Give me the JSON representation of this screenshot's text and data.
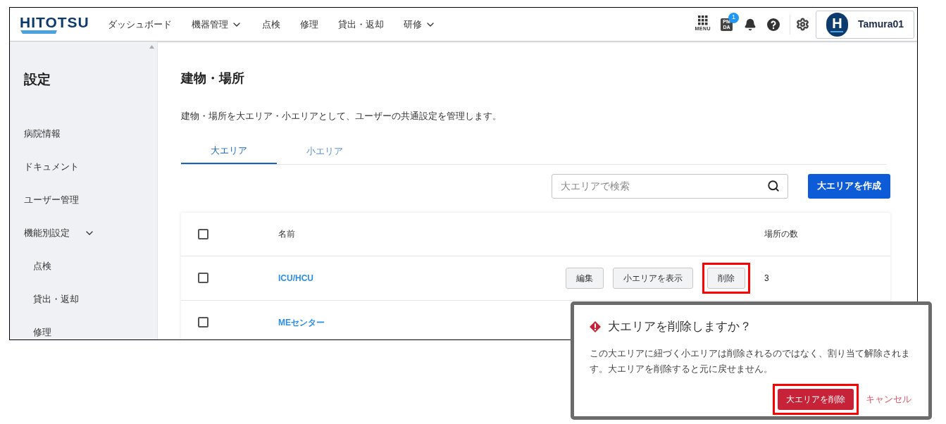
{
  "header": {
    "logo": "HITOTSU",
    "nav": [
      {
        "label": "ダッシュボード",
        "dropdown": false
      },
      {
        "label": "機器管理",
        "dropdown": true
      },
      {
        "label": "点検",
        "dropdown": false
      },
      {
        "label": "修理",
        "dropdown": false
      },
      {
        "label": "貸出・返却",
        "dropdown": false
      },
      {
        "label": "研修",
        "dropdown": true
      }
    ],
    "menu_label": "MENU",
    "pmda": {
      "top": "PM",
      "bottom": "DA",
      "count": "1"
    },
    "user": {
      "initial": "H",
      "name": "Tamura01"
    }
  },
  "sidebar": {
    "title": "設定",
    "items": [
      {
        "label": "病院情報"
      },
      {
        "label": "ドキュメント"
      },
      {
        "label": "ユーザー管理"
      },
      {
        "label": "機能別設定",
        "expanded": true,
        "children": [
          {
            "label": "点検"
          },
          {
            "label": "貸出・返却"
          },
          {
            "label": "修理"
          }
        ]
      }
    ]
  },
  "page": {
    "title": "建物・場所",
    "description": "建物・場所を大エリア・小エリアとして、ユーザーの共通設定を管理します。",
    "tabs": [
      {
        "label": "大エリア",
        "selected": true
      },
      {
        "label": "小エリア",
        "selected": false
      }
    ],
    "search": {
      "placeholder": "大エリアで検索"
    },
    "create_button": "大エリアを作成",
    "table": {
      "header_checked": false,
      "columns": [
        "名前",
        "場所の数"
      ],
      "rows": [
        {
          "checked": false,
          "name": "ICU/HCU",
          "count": "3",
          "actions": [
            {
              "label": "編集",
              "highlighted": false
            },
            {
              "label": "小エリアを表示",
              "highlighted": false
            },
            {
              "label": "削除",
              "highlighted": true
            }
          ]
        },
        {
          "checked": false,
          "name": "MEセンター"
        }
      ]
    }
  },
  "dialog": {
    "title": "大エリアを削除しますか？",
    "message": "この大エリアに紐づく小エリアは削除されるのではなく、割り当て解除されます。大エリアを削除すると元に戻せません。",
    "confirm": {
      "label": "大エリアを削除",
      "highlighted": true
    },
    "cancel": "キャンセル"
  }
}
